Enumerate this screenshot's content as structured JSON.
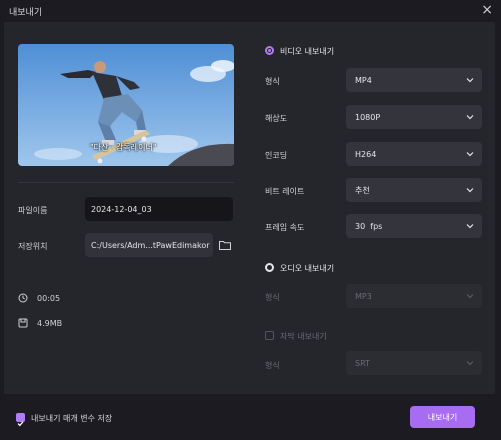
{
  "window": {
    "title": "내보내기"
  },
  "preview": {
    "subtitle": "\"다산 · 감독레이너\""
  },
  "file": {
    "name_label": "파일이름",
    "name_value": "2024-12-04_03",
    "path_label": "저장위치",
    "path_value": "C:/Users/Adm...tPawEdimakor"
  },
  "info": {
    "duration": "00:05",
    "size": "4.9MB"
  },
  "video_export": {
    "label": "비디오 내보내기",
    "rows": [
      {
        "label": "형식",
        "value": "MP4"
      },
      {
        "label": "해상도",
        "value": "1080P"
      },
      {
        "label": "인코딩",
        "value": "H264"
      },
      {
        "label": "비트 레이트",
        "value": "추천"
      },
      {
        "label": "프레임 속도",
        "value": "30  fps"
      }
    ]
  },
  "audio_export": {
    "label": "오디오 내보내기",
    "format_label": "형식",
    "format_value": "MP3"
  },
  "subtitle_export": {
    "label": "자막 내보내기",
    "format_label": "형식",
    "format_value": "SRT"
  },
  "footer": {
    "remember_label": "내보내기 매개 변수 저장",
    "export_button": "내보내기"
  },
  "colors": {
    "accent": "#a86cf2",
    "panel": "#25252c",
    "background": "#1b1b21"
  }
}
